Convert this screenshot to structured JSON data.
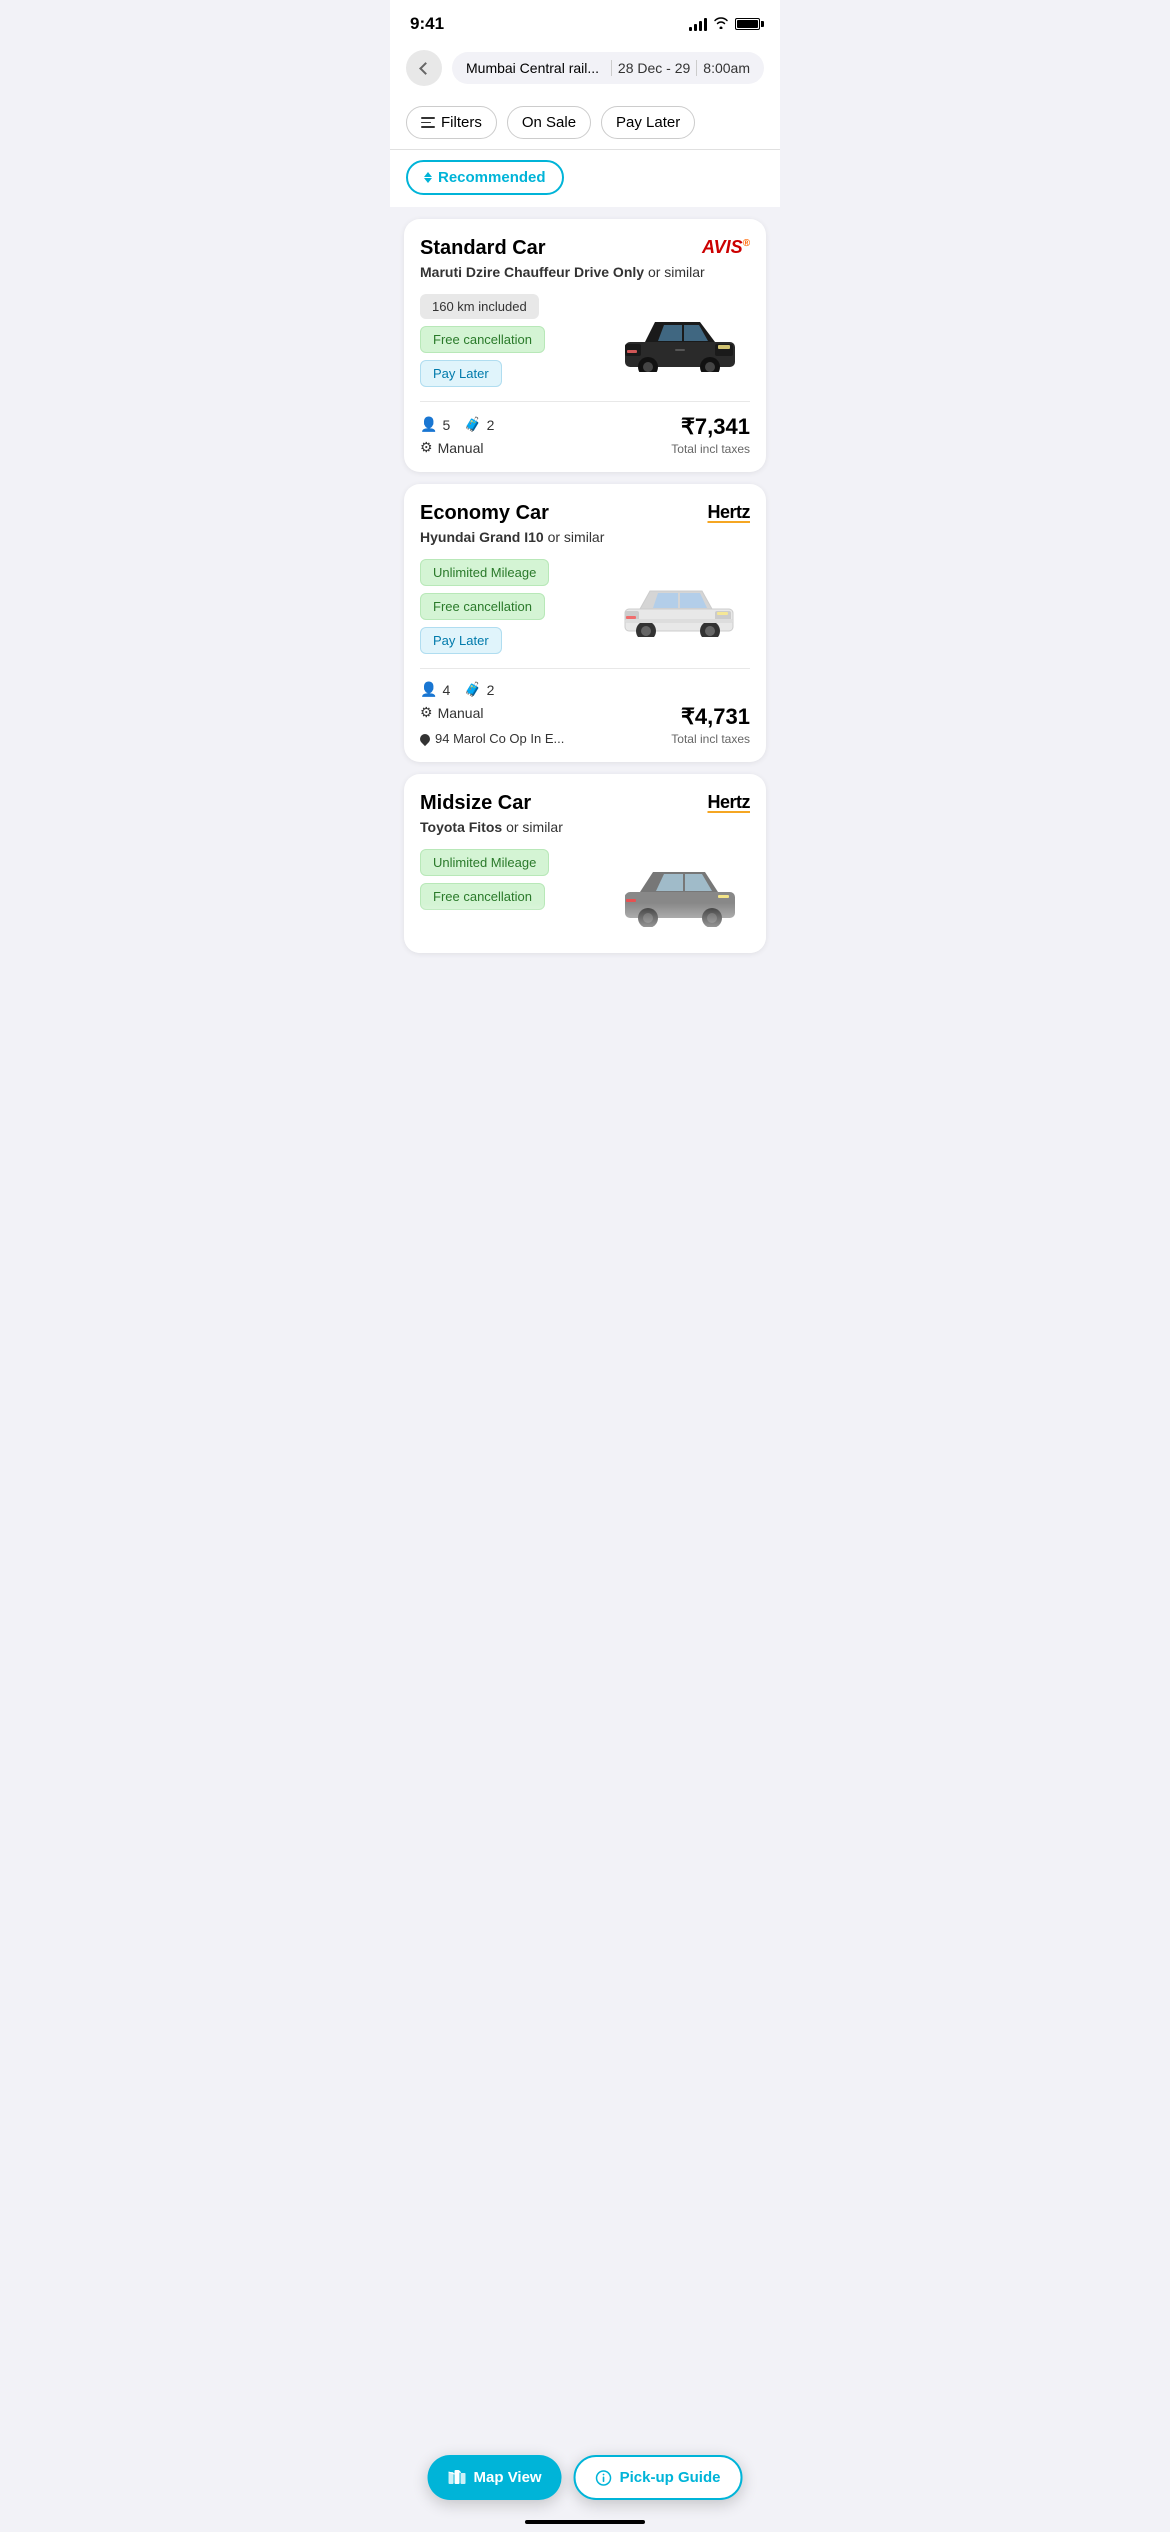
{
  "statusBar": {
    "time": "9:41",
    "signal": "full",
    "wifi": true,
    "battery": "full"
  },
  "searchBar": {
    "backLabel": "back",
    "location": "Mumbai Central rail...",
    "dates": "28 Dec - 29",
    "time": "8:00am"
  },
  "filters": {
    "filtersLabel": "Filters",
    "onSaleLabel": "On Sale",
    "payLaterLabel": "Pay Later"
  },
  "sort": {
    "recommendedLabel": "Recommended"
  },
  "cards": [
    {
      "type": "Standard Car",
      "brand": "AVIS",
      "brandType": "avis",
      "model": "Maruti Dzire Chauffeur Drive Only",
      "modelSuffix": "or similar",
      "tags": [
        {
          "text": "160 km included",
          "style": "grey"
        },
        {
          "text": "Free cancellation",
          "style": "green"
        },
        {
          "text": "Pay Later",
          "style": "blue"
        }
      ],
      "passengers": "5",
      "luggage": "2",
      "transmission": "Manual",
      "price": "₹7,341",
      "priceLabel": "Total incl taxes",
      "location": null
    },
    {
      "type": "Economy Car",
      "brand": "Hertz",
      "brandType": "hertz",
      "model": "Hyundai Grand I10",
      "modelSuffix": "or similar",
      "tags": [
        {
          "text": "Unlimited Mileage",
          "style": "green"
        },
        {
          "text": "Free cancellation",
          "style": "green"
        },
        {
          "text": "Pay Later",
          "style": "blue"
        }
      ],
      "passengers": "4",
      "luggage": "2",
      "transmission": "Manual",
      "price": "₹4,731",
      "priceLabel": "Total incl taxes",
      "location": "94 Marol Co Op In E..."
    },
    {
      "type": "Midsize Car",
      "brand": "Hertz",
      "brandType": "hertz",
      "model": "Toyota Fitos",
      "modelSuffix": "or similar",
      "tags": [
        {
          "text": "Unlimited Mileage",
          "style": "green"
        },
        {
          "text": "Free cancellation",
          "style": "green"
        }
      ],
      "passengers": null,
      "luggage": null,
      "transmission": null,
      "price": null,
      "priceLabel": null,
      "location": null
    }
  ],
  "bottomBar": {
    "mapViewLabel": "Map View",
    "pickupGuideLabel": "Pick-up Guide"
  }
}
